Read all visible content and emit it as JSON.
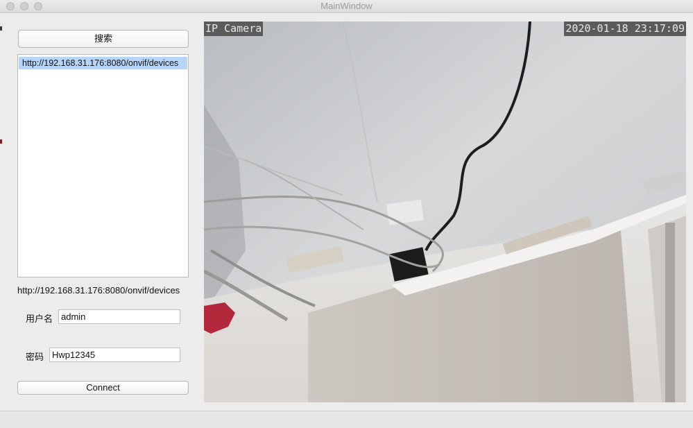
{
  "window": {
    "title": "MainWindow"
  },
  "left_panel": {
    "search_button_label": "搜索",
    "device_list": [
      "http://192.168.31.176:8080/onvif/devices"
    ],
    "selected_device_url": "http://192.168.31.176:8080/onvif/devices",
    "username_label": "用户名",
    "username_value": "admin",
    "password_label": "密码",
    "password_value": "Hwp12345",
    "connect_button_label": "Connect"
  },
  "camera_view": {
    "osd_title": "IP Camera",
    "osd_timestamp": "2020-01-18 23:17:09"
  }
}
